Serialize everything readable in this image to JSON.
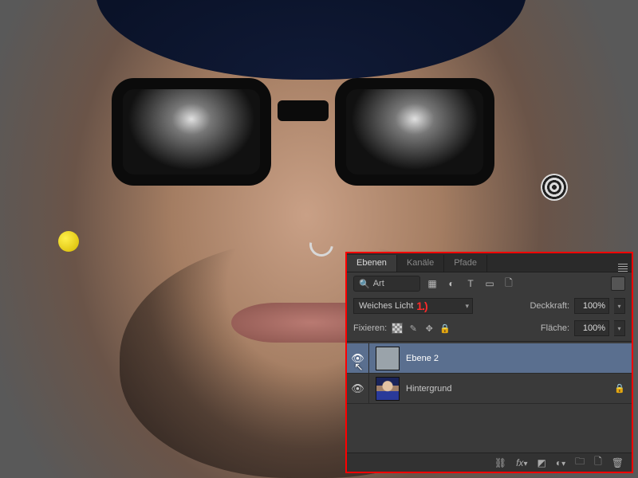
{
  "panel": {
    "tabs": {
      "layers": "Ebenen",
      "channels": "Kanäle",
      "paths": "Pfade"
    },
    "search_label": "Art",
    "filter_icons": [
      "image-icon",
      "adjust-icon",
      "type-icon",
      "shape-icon",
      "smart-icon"
    ],
    "blend_mode": "Weiches Licht",
    "annotation_mark": "1.)",
    "opacity_label": "Deckkraft:",
    "opacity_value": "100%",
    "lock_label": "Fixieren:",
    "fill_label": "Fläche:",
    "fill_value": "100%",
    "layers": [
      {
        "name": "Ebene 2",
        "selected": true,
        "locked": false
      },
      {
        "name": "Hintergrund",
        "selected": false,
        "locked": true
      }
    ],
    "footer_icons": [
      "link-icon",
      "fx-icon",
      "mask-icon",
      "adjustment-icon",
      "group-icon",
      "new-icon",
      "trash-icon"
    ]
  }
}
